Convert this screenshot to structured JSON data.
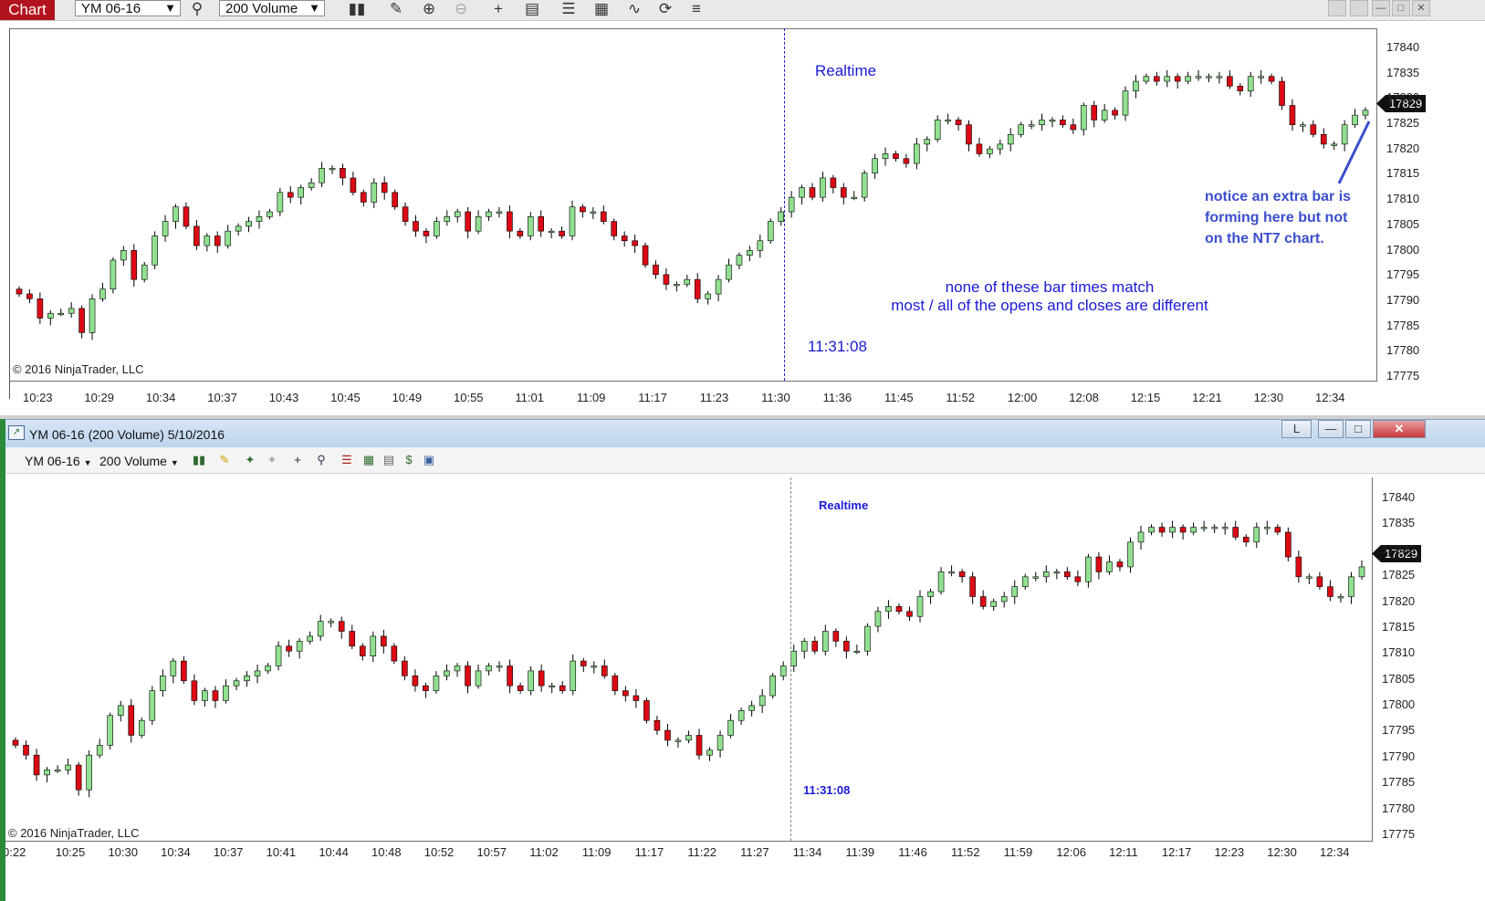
{
  "toolbar": {
    "chart_tab": "Chart",
    "instrument": "YM 06-16",
    "interval": "200 Volume",
    "icons": [
      "search-icon",
      "bar-type-icon",
      "pencil-icon",
      "zoom-in-icon",
      "zoom-out-icon",
      "crosshair-icon",
      "data-box-icon",
      "strategies-icon",
      "indicators-icon",
      "drawing-tools-icon",
      "reload-icon",
      "properties-icon"
    ]
  },
  "colors": {
    "up": "#90e090",
    "down": "#dc0a14",
    "wick": "#000000",
    "annotation": "#1a1ad6",
    "annotation_bold": "#3a4fcc",
    "separator_nt8": "#2020c8",
    "separator_nt7": "#8a8a8a"
  },
  "nt8": {
    "realtime_label": "Realtime",
    "time_label": "11:31:08",
    "copyright": "© 2016 NinjaTrader, LLC",
    "last_price": "17829",
    "price_ticks": [
      "17840",
      "17835",
      "17830",
      "17825",
      "17820",
      "17815",
      "17810",
      "17805",
      "17800",
      "17795",
      "17790",
      "17785",
      "17780",
      "17775"
    ],
    "time_ticks": [
      "10:23",
      "10:29",
      "10:34",
      "10:37",
      "10:43",
      "10:45",
      "10:49",
      "10:55",
      "11:01",
      "11:09",
      "11:17",
      "11:23",
      "11:30",
      "11:36",
      "11:45",
      "11:52",
      "12:00",
      "12:08",
      "12:15",
      "12:21",
      "12:30",
      "12:34"
    ],
    "note_middle_1": "none of these bar times match",
    "note_middle_2": "most / all of the opens and closes are different",
    "note_right_1": "notice an extra bar is",
    "note_right_2": "forming here but not",
    "note_right_3": "on the NT7 chart."
  },
  "nt7": {
    "title": "YM 06-16 (200 Volume)  5/10/2016",
    "instrument": "YM 06-16",
    "interval": "200 Volume",
    "link_button": "L",
    "realtime_label": "Realtime",
    "time_label": "11:31:08",
    "copyright": "© 2016 NinjaTrader, LLC",
    "last_price": "17829",
    "price_ticks": [
      "17840",
      "17835",
      "17830",
      "17825",
      "17820",
      "17815",
      "17810",
      "17805",
      "17800",
      "17795",
      "17790",
      "17785",
      "17780",
      "17775"
    ],
    "time_ticks": [
      "0:22",
      "10:25",
      "10:30",
      "10:34",
      "10:37",
      "10:41",
      "10:44",
      "10:48",
      "10:52",
      "10:57",
      "11:02",
      "11:09",
      "11:17",
      "11:22",
      "11:27",
      "11:34",
      "11:39",
      "11:46",
      "11:52",
      "11:59",
      "12:06",
      "12:11",
      "12:17",
      "12:23",
      "12:30",
      "12:34"
    ]
  },
  "chart_data": [
    {
      "type": "candlestick",
      "title": "",
      "instrument": "YM 06-16",
      "interval": "200 Volume",
      "ylim": [
        17774,
        17842
      ],
      "close": [
        17791,
        17790,
        17786,
        17787,
        17787,
        17788,
        17783,
        17790,
        17792,
        17798,
        17800,
        17794,
        17797,
        17803,
        17806,
        17809,
        17805,
        17801,
        17803,
        17801,
        17804,
        17805,
        17806,
        17807,
        17808,
        17812,
        17811,
        17813,
        17814,
        17817,
        17817,
        17815,
        17812,
        17810,
        17814,
        17812,
        17809,
        17806,
        17804,
        17803,
        17806,
        17807,
        17808,
        17804,
        17807,
        17808,
        17808,
        17804,
        17803,
        17807,
        17804,
        17804,
        17803,
        17809,
        17808,
        17808,
        17806,
        17803,
        17802,
        17801,
        17797,
        17795,
        17793,
        17793,
        17794,
        17790,
        17791,
        17794,
        17797,
        17799,
        17800,
        17802,
        17806,
        17808,
        17811,
        17813,
        17811,
        17815,
        17813,
        17811,
        17811,
        17816,
        17819,
        17820,
        17819,
        17818,
        17822,
        17823,
        17827,
        17827,
        17826,
        17822,
        17820,
        17821,
        17822,
        17824,
        17826,
        17826,
        17827,
        17827,
        17826,
        17825,
        17830,
        17827,
        17829,
        17828,
        17833,
        17835,
        17836,
        17835,
        17836,
        17835,
        17836,
        17836,
        17836,
        17836,
        17834,
        17833,
        17836,
        17836,
        17835,
        17830,
        17826,
        17826,
        17824,
        17822,
        17822,
        17826,
        17828,
        17829
      ],
      "last_price": 17829
    },
    {
      "type": "candlestick",
      "title": "",
      "instrument": "YM 06-16",
      "interval": "200 Volume",
      "ylim": [
        17774,
        17842
      ],
      "close": [
        17792,
        17790,
        17786,
        17787,
        17787,
        17788,
        17783,
        17790,
        17792,
        17798,
        17800,
        17794,
        17797,
        17803,
        17806,
        17809,
        17805,
        17801,
        17803,
        17801,
        17804,
        17805,
        17806,
        17807,
        17808,
        17812,
        17811,
        17813,
        17814,
        17817,
        17817,
        17815,
        17812,
        17810,
        17814,
        17812,
        17809,
        17806,
        17804,
        17803,
        17806,
        17807,
        17808,
        17804,
        17807,
        17808,
        17808,
        17804,
        17803,
        17807,
        17804,
        17804,
        17803,
        17809,
        17808,
        17808,
        17806,
        17803,
        17802,
        17801,
        17797,
        17795,
        17793,
        17793,
        17794,
        17790,
        17791,
        17794,
        17797,
        17799,
        17800,
        17802,
        17806,
        17808,
        17811,
        17813,
        17811,
        17815,
        17813,
        17811,
        17811,
        17816,
        17819,
        17820,
        17819,
        17818,
        17822,
        17823,
        17827,
        17827,
        17826,
        17822,
        17820,
        17821,
        17822,
        17824,
        17826,
        17826,
        17827,
        17827,
        17826,
        17825,
        17830,
        17827,
        17829,
        17828,
        17833,
        17835,
        17836,
        17835,
        17836,
        17835,
        17836,
        17836,
        17836,
        17836,
        17834,
        17833,
        17836,
        17836,
        17835,
        17830,
        17826,
        17826,
        17824,
        17822,
        17822,
        17826,
        17828
      ],
      "last_price": 17829
    }
  ]
}
